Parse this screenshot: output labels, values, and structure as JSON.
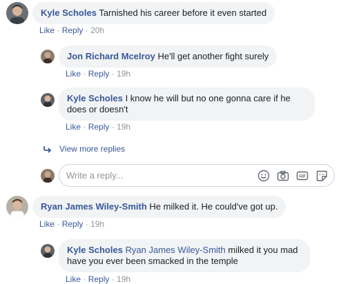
{
  "comments": [
    {
      "author": "Kyle Scholes",
      "text": "Tarnished his career before it even started",
      "like": "Like",
      "reply": "Reply",
      "time": "20h",
      "replies": [
        {
          "author": "Jon Richard Mcelroy",
          "text": "He'll get another fight surely",
          "like": "Like",
          "reply": "Reply",
          "time": "19h"
        },
        {
          "author": "Kyle Scholes",
          "text": "I know he will but no one gonna care if he does or doesn't",
          "line1": "I know he will but no one gonna care if he",
          "line2": "does or doesn't",
          "like": "Like",
          "reply": "Reply",
          "time": "19h"
        }
      ],
      "view_more": "View more replies",
      "write_placeholder": "Write a reply..."
    },
    {
      "author": "Ryan James Wiley-Smith",
      "text": "He milked it. He could've got up.",
      "like": "Like",
      "reply": "Reply",
      "time": "19h",
      "replies": [
        {
          "author": "Kyle Scholes",
          "mention": "Ryan James Wiley-Smith",
          "line1_rest": "milked it you mad",
          "line2": "have you ever been smacked in the temple",
          "like": "Like",
          "reply": "Reply",
          "time": "19h"
        }
      ]
    }
  ],
  "icons": [
    "reply-arrow-icon",
    "emoji-icon",
    "camera-icon",
    "gif-icon",
    "sticker-icon"
  ],
  "colors": {
    "link": "#385898",
    "bubble": "#f2f3f5",
    "muted": "#90949c"
  }
}
